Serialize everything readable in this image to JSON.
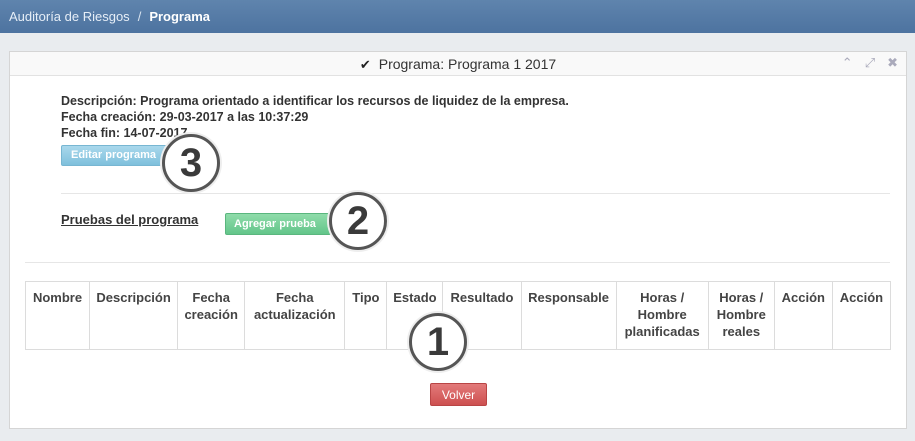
{
  "breadcrumb": {
    "parent": "Auditoría de Riesgos",
    "separator": "/",
    "current": "Programa"
  },
  "panel": {
    "title": "Programa: Programa 1 2017",
    "check_icon": "✔",
    "tools": {
      "collapse_icon": "⌃",
      "expand_icon": "⤢",
      "close_icon": "✖"
    }
  },
  "program": {
    "description": "Descripción: Programa orientado a identificar los recursos de liquidez de la empresa.",
    "created": "Fecha creación: 29-03-2017 a las 10:37:29",
    "end": "Fecha fin: 14-07-2017",
    "edit_label": "Editar programa"
  },
  "tests": {
    "label": "Pruebas del programa",
    "add_label": "Agregar prueba"
  },
  "table": {
    "headers": [
      [
        "Nombre"
      ],
      [
        "Descripción"
      ],
      [
        "Fecha",
        "creación"
      ],
      [
        "Fecha",
        "actualización"
      ],
      [
        "Tipo"
      ],
      [
        "Estado"
      ],
      [
        "Resultado"
      ],
      [
        "Responsable"
      ],
      [
        "Horas /",
        "Hombre",
        "planificadas"
      ],
      [
        "Horas /",
        "Hombre",
        "reales"
      ],
      [
        "Acción"
      ],
      [
        "Acción"
      ]
    ]
  },
  "back_label": "Volver",
  "badges": {
    "one": "1",
    "two": "2",
    "three": "3"
  }
}
